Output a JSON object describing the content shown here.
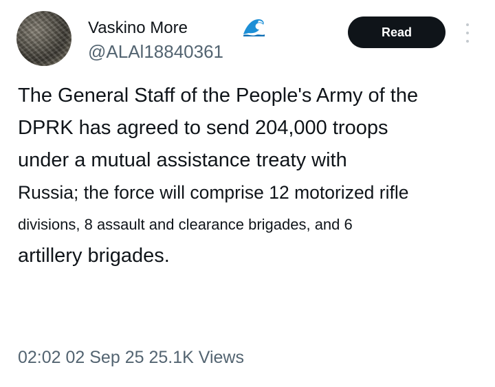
{
  "author": {
    "display_name": "Vaskino More",
    "handle": "@ALAl18840361",
    "emoji_icon": "water-wave-icon"
  },
  "actions": {
    "read_label": "Read"
  },
  "tweet": {
    "lines": [
      "The General Staff of the People's Army of the",
      "DPRK has agreed to send 204,000 troops",
      "under a mutual assistance treaty with",
      "Russia; the force will comprise 12 motorized rifle",
      "divisions, 8 assault and clearance brigades, and 6",
      "artillery brigades."
    ]
  },
  "meta": {
    "timestamp_and_views": "02:02 02 Sep 25 25.1K Views"
  },
  "colors": {
    "text": "#0f1419",
    "secondary": "#536471",
    "button_bg": "#0f1419",
    "button_text": "#ffffff",
    "wave_blue": "#1d8fd6"
  }
}
